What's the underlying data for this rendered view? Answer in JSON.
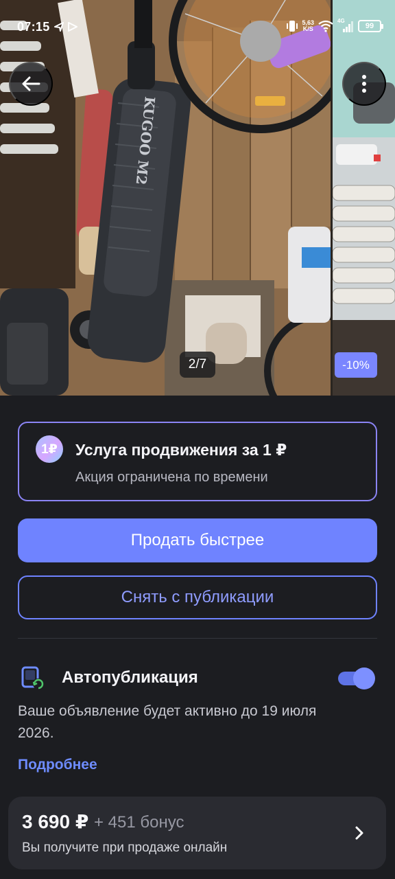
{
  "status_bar": {
    "time": "07:15",
    "net_speed": "5,63",
    "net_unit": "K/S",
    "network_type": "4G",
    "battery": "99"
  },
  "gallery": {
    "counter": "2/7",
    "discount_badge": "-10%",
    "back_icon": "arrow-left-icon",
    "more_icon": "more-vertical-icon"
  },
  "promo": {
    "icon_text": "1₽",
    "title": "Услуга продвижения за 1 ₽",
    "subtitle": "Акция ограничена по времени"
  },
  "actions": {
    "sell_faster": "Продать быстрее",
    "unpublish": "Снять с публикации"
  },
  "autopublish": {
    "title": "Автопубликация",
    "enabled": true,
    "description": "Ваше объявление будет активно до 19 июля 2026.",
    "more_link": "Подробнее"
  },
  "sale_card": {
    "price": "3 690 ₽",
    "bonus": "+ 451 бонус",
    "subtitle": "Вы получите при продаже онлайн"
  },
  "colors": {
    "accent": "#6f83ff",
    "background": "#1c1d21",
    "link": "#6e8cff"
  }
}
